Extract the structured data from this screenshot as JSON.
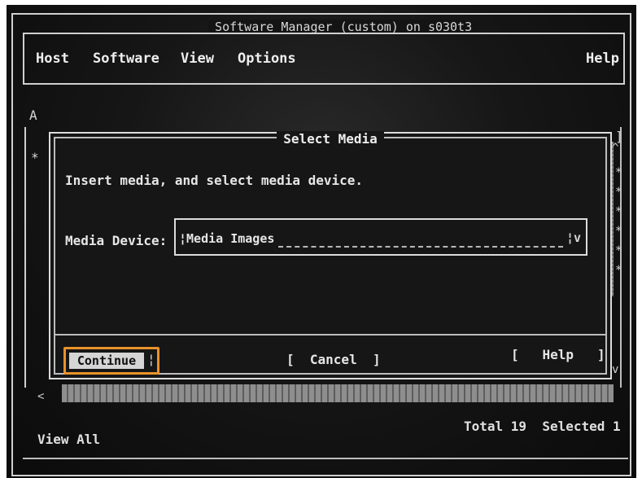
{
  "window": {
    "title": "Software Manager (custom) on s030t3"
  },
  "menu": {
    "items": [
      "Host",
      "Software",
      "View",
      "Options"
    ],
    "help": "Help"
  },
  "background": {
    "label_a": "A",
    "label_star": "*",
    "bracket": "]",
    "stars": "*\n*\n*\n*\n*\n*"
  },
  "dialog": {
    "title": "Select Media",
    "instruction": "Insert media, and select media device.",
    "media_device": {
      "label": "Media Device:",
      "value": "¦Media Images",
      "dropdown_glyph": "¦v"
    },
    "buttons": {
      "continue": "Continue",
      "continue_mark": "¦",
      "cancel": "[  Cancel  ]",
      "help": "[   Help   ]"
    }
  },
  "scroll": {
    "left_glyph": "<",
    "up_glyph": "^",
    "down_glyph": "v"
  },
  "status": {
    "view": "View All",
    "summary": "Total 19  Selected 1"
  },
  "colors": {
    "focus_border": "#e8932a",
    "screen_bg": "#141414",
    "text": "#e3e3e3"
  }
}
